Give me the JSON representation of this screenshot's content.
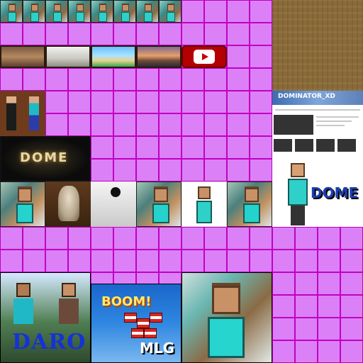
{
  "atlas": {
    "background_colors": {
      "grid_fill": "#dc80f8",
      "grid_lines": "#c000c0"
    },
    "banners": {
      "channel_title": "DOMINATOR_XD",
      "dome_small": "DOME",
      "dome_big": "DOME",
      "daro": "DARO",
      "boom": "BOOM!",
      "mlg": "MLG"
    }
  }
}
